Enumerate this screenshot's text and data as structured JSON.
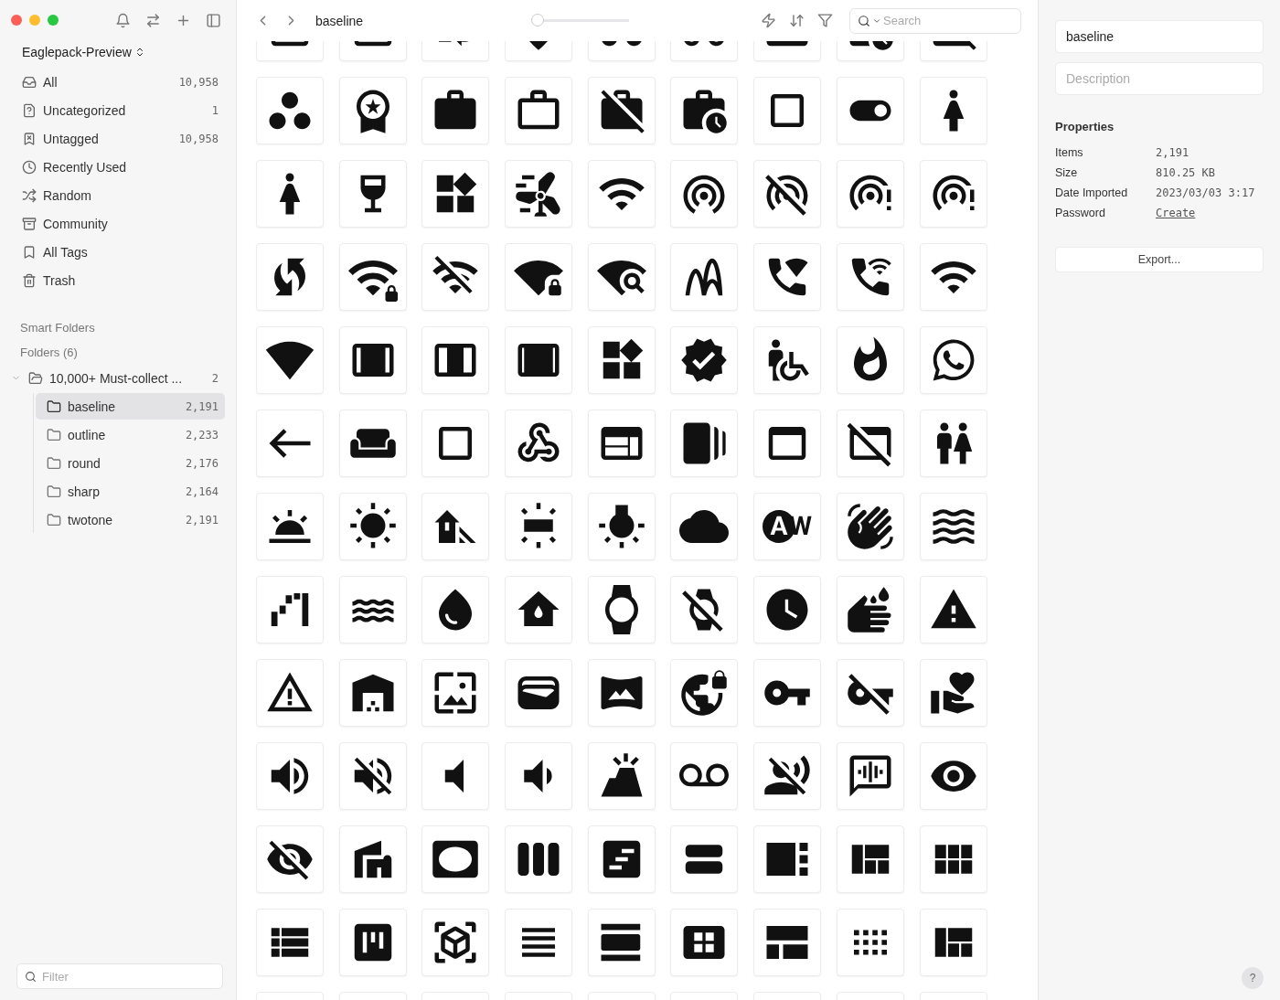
{
  "sidebar": {
    "library": "Eaglepack-Preview",
    "nav": [
      {
        "label": "All",
        "count": "10,958",
        "selected": false
      },
      {
        "label": "Uncategorized",
        "count": "1",
        "selected": false
      },
      {
        "label": "Untagged",
        "count": "10,958",
        "selected": false
      },
      {
        "label": "Recently Used",
        "selected": false
      },
      {
        "label": "Random",
        "selected": false
      },
      {
        "label": "Community",
        "selected": false
      },
      {
        "label": "All Tags",
        "selected": false
      },
      {
        "label": "Trash",
        "selected": false
      }
    ],
    "smart_folders": "Smart Folders",
    "folders_heading": "Folders (6)",
    "folders": [
      {
        "label": "10,000+ Must-collect ...",
        "count": "2",
        "expanded": true,
        "selected": false,
        "children": [
          {
            "label": "baseline",
            "count": "2,191",
            "selected": true
          },
          {
            "label": "outline",
            "count": "2,233",
            "selected": false
          },
          {
            "label": "round",
            "count": "2,176",
            "selected": false
          },
          {
            "label": "sharp",
            "count": "2,164",
            "selected": false
          },
          {
            "label": "twotone",
            "count": "2,191",
            "selected": false
          }
        ]
      }
    ],
    "filter": {
      "placeholder": "Filter"
    }
  },
  "toolbar": {
    "title": "baseline",
    "zoom": {
      "level": 0
    },
    "search": {
      "placeholder": "Search"
    }
  },
  "details": {
    "name": "baseline",
    "description": {
      "placeholder": "Description"
    },
    "properties_title": "Properties",
    "properties": [
      {
        "label": "Items",
        "value": "2,191",
        "kind": "text"
      },
      {
        "label": "Size",
        "value": "810.25 KB",
        "kind": "text"
      },
      {
        "label": "Date Imported",
        "value": "2023/03/03 3:17",
        "kind": "text"
      },
      {
        "label": "Password",
        "value": "Create",
        "kind": "link"
      }
    ],
    "export": "Export...",
    "help": "?"
  }
}
